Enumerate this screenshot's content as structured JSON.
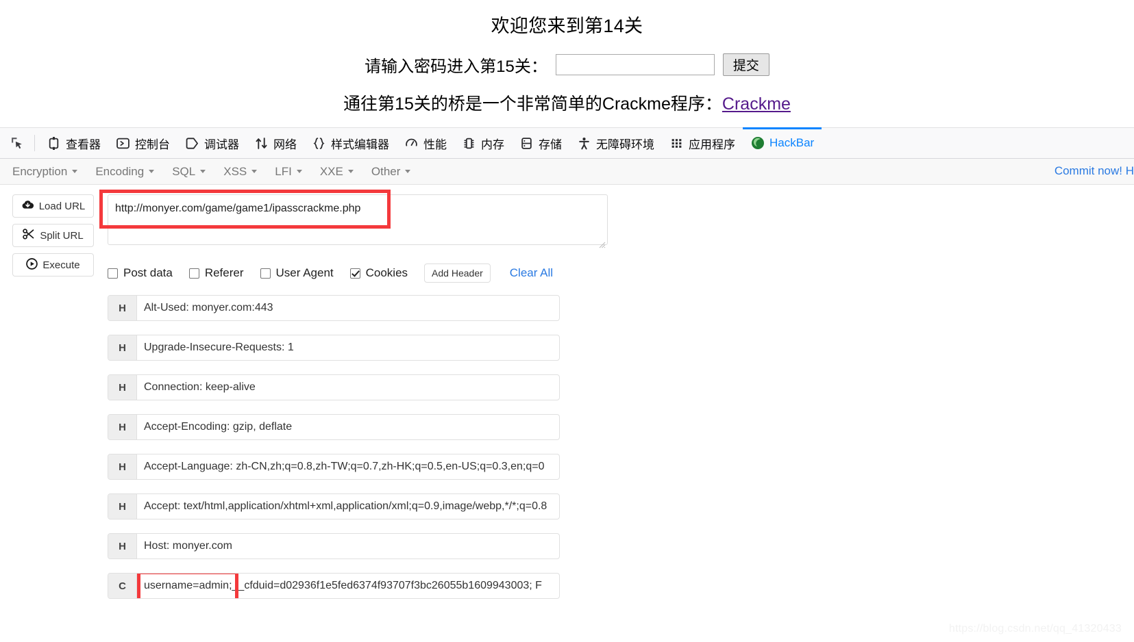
{
  "webpage": {
    "title": "欢迎您来到第14关",
    "password_label": "请输入密码进入第15关：",
    "password_value": "",
    "password_placeholder": "",
    "submit_label": "提交",
    "bridge_text": "通往第15关的桥是一个非常简单的Crackme程序：",
    "bridge_link": "Crackme"
  },
  "devtools": {
    "picker_icon": "element-picker-icon",
    "tabs": [
      {
        "label": "查看器",
        "icon": "inspector-icon",
        "active": false
      },
      {
        "label": "控制台",
        "icon": "console-icon",
        "active": false
      },
      {
        "label": "调试器",
        "icon": "debugger-icon",
        "active": false
      },
      {
        "label": "网络",
        "icon": "network-icon",
        "active": false
      },
      {
        "label": "样式编辑器",
        "icon": "style-editor-icon",
        "active": false
      },
      {
        "label": "性能",
        "icon": "performance-icon",
        "active": false
      },
      {
        "label": "内存",
        "icon": "memory-icon",
        "active": false
      },
      {
        "label": "存储",
        "icon": "storage-icon",
        "active": false
      },
      {
        "label": "无障碍环境",
        "icon": "accessibility-icon",
        "active": false
      },
      {
        "label": "应用程序",
        "icon": "application-icon",
        "active": false
      },
      {
        "label": "HackBar",
        "icon": "hackbar-icon",
        "active": true
      }
    ],
    "active_tab_color": "#0a84ff"
  },
  "hackbar": {
    "menus": [
      {
        "label": "Encryption"
      },
      {
        "label": "Encoding"
      },
      {
        "label": "SQL"
      },
      {
        "label": "XSS"
      },
      {
        "label": "LFI"
      },
      {
        "label": "XXE"
      },
      {
        "label": "Other"
      }
    ],
    "commit_text": "Commit now! H",
    "commit_color": "#2a7ae2",
    "buttons": [
      {
        "label": "Load URL",
        "icon": "cloud-download-icon"
      },
      {
        "label": "Split URL",
        "icon": "scissors-icon"
      },
      {
        "label": "Execute",
        "icon": "play-circle-icon"
      }
    ],
    "url_value": "http://monyer.com/game/game1/ipasscrackme.php",
    "url_placeholder": "",
    "options": [
      {
        "label": "Post data",
        "checked": false
      },
      {
        "label": "Referer",
        "checked": false
      },
      {
        "label": "User Agent",
        "checked": false
      },
      {
        "label": "Cookies",
        "checked": true
      }
    ],
    "add_header_label": "Add Header",
    "clear_all_label": "Clear All",
    "headers": [
      {
        "tag": "H",
        "value": "Alt-Used: monyer.com:443"
      },
      {
        "tag": "H",
        "value": "Upgrade-Insecure-Requests: 1"
      },
      {
        "tag": "H",
        "value": "Connection: keep-alive"
      },
      {
        "tag": "H",
        "value": "Accept-Encoding: gzip, deflate"
      },
      {
        "tag": "H",
        "value": "Accept-Language: zh-CN,zh;q=0.8,zh-TW;q=0.7,zh-HK;q=0.5,en-US;q=0.3,en;q=0"
      },
      {
        "tag": "H",
        "value": "Accept: text/html,application/xhtml+xml,application/xml;q=0.9,image/webp,*/*;q=0.8"
      },
      {
        "tag": "H",
        "value": "Host: monyer.com"
      }
    ],
    "cookie_row": {
      "tag": "C",
      "highlighted_part": "username=admin;",
      "rest": "__cfduid=d02936f1e5fed6374f93707f3bc26055b1609943003; F"
    },
    "highlight_color": "#f4393c"
  },
  "watermark": "https://blog.csdn.net/qq_41320433"
}
